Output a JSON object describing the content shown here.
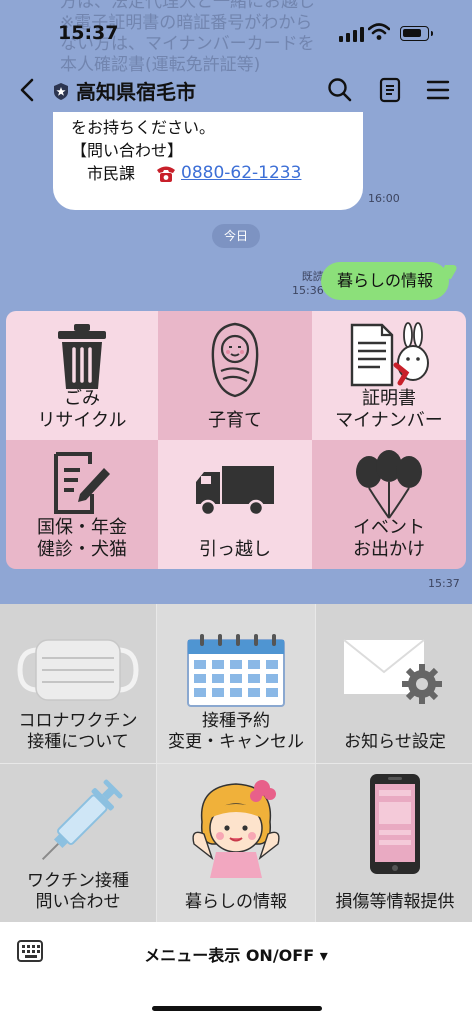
{
  "status": {
    "time": "15:37"
  },
  "header": {
    "title": "高知県宿毛市"
  },
  "background_text": {
    "lines": [
      "方は、法定代理人と一緒にお越し",
      "※電子証明書の暗証番号がわから",
      "ない方は、マイナンバーカードを",
      "本人確認書(運転免許証等)"
    ]
  },
  "messages": {
    "incoming": {
      "line1": "をお持ちください。",
      "line2": "【問い合わせ】",
      "line3_label": "市民課",
      "phone": "0880-62-1233",
      "time": "16:00"
    },
    "date_separator": "今日",
    "outgoing": {
      "text": "暮らしの情報",
      "read": "既読",
      "time": "15:36"
    }
  },
  "rich_menu": {
    "items": [
      {
        "label1": "ごみ",
        "label2": "リサイクル",
        "icon": "trash-icon"
      },
      {
        "label1": "子育て",
        "label2": "",
        "icon": "baby-icon"
      },
      {
        "label1": "証明書",
        "label2": "マイナンバー",
        "icon": "certificate-icon"
      },
      {
        "label1": "国保・年金",
        "label2": "健診・犬猫",
        "icon": "document-pen-icon"
      },
      {
        "label1": "引っ越し",
        "label2": "",
        "icon": "truck-icon"
      },
      {
        "label1": "イベント",
        "label2": "お出かけ",
        "icon": "balloons-icon"
      }
    ],
    "time": "15:37"
  },
  "menu": {
    "items": [
      {
        "label1": "コロナワクチン",
        "label2": "接種について",
        "icon": "mask-icon"
      },
      {
        "label1": "接種予約",
        "label2": "変更・キャンセル",
        "icon": "calendar-icon"
      },
      {
        "label1": "お知らせ設定",
        "label2": "",
        "icon": "mail-gear-icon"
      },
      {
        "label1": "ワクチン接種",
        "label2": "問い合わせ",
        "icon": "syringe-icon"
      },
      {
        "label1": "暮らしの情報",
        "label2": "",
        "icon": "girl-mascot-icon"
      },
      {
        "label1": "損傷等情報提供",
        "label2": "",
        "icon": "smartphone-icon"
      }
    ]
  },
  "bottom": {
    "toggle_label": "メニュー表示 ON/OFF ▾"
  }
}
